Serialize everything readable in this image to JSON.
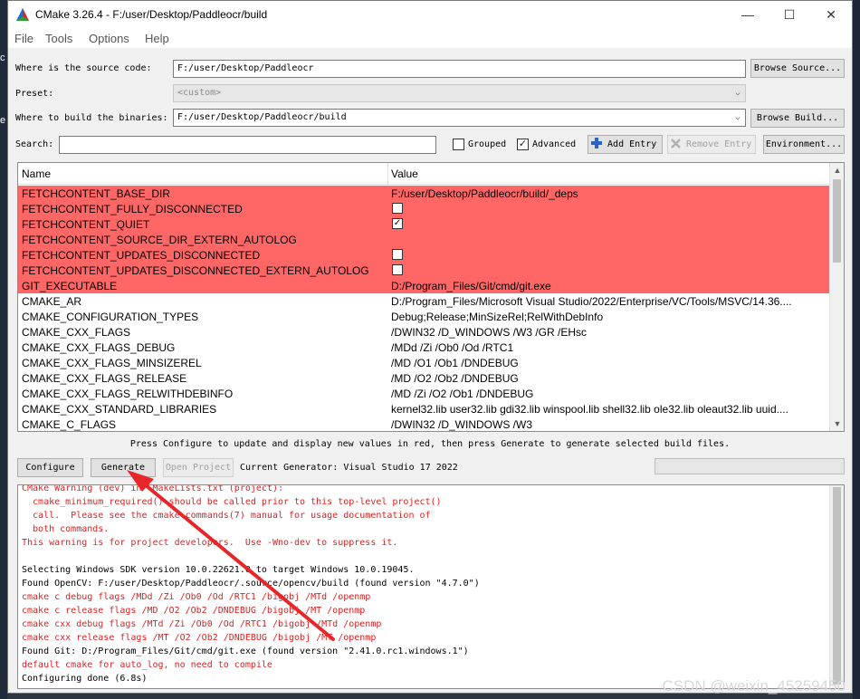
{
  "window": {
    "title": "CMake 3.26.4 - F:/user/Desktop/Paddleocr/build",
    "minimize_glyph": "—",
    "maximize_glyph": "☐",
    "close_glyph": "✕"
  },
  "menu": [
    "File",
    "Tools",
    "Options",
    "Help"
  ],
  "source": {
    "label": "Where is the source code:",
    "value": "F:/user/Desktop/Paddleocr",
    "button": "Browse Source..."
  },
  "preset": {
    "label": "Preset:",
    "value": "<custom>"
  },
  "build": {
    "label": "Where to build the binaries:",
    "value": "F:/user/Desktop/Paddleocr/build",
    "button": "Browse Build..."
  },
  "search": {
    "label": "Search:",
    "value": "",
    "grouped_label": "Grouped",
    "grouped_checked": false,
    "advanced_label": "Advanced",
    "advanced_checked": true,
    "add_entry": "Add Entry",
    "remove_entry": "Remove Entry",
    "environment": "Environment..."
  },
  "table": {
    "headers": [
      "Name",
      "Value"
    ],
    "rows": [
      {
        "name": "FETCHCONTENT_BASE_DIR",
        "value": "F:/user/Desktop/Paddleocr/build/_deps",
        "type": "text",
        "new": true
      },
      {
        "name": "FETCHCONTENT_FULLY_DISCONNECTED",
        "value": "",
        "type": "bool",
        "checked": false,
        "new": true
      },
      {
        "name": "FETCHCONTENT_QUIET",
        "value": "",
        "type": "bool",
        "checked": true,
        "new": true
      },
      {
        "name": "FETCHCONTENT_SOURCE_DIR_EXTERN_AUTOLOG",
        "value": "",
        "type": "text",
        "new": true
      },
      {
        "name": "FETCHCONTENT_UPDATES_DISCONNECTED",
        "value": "",
        "type": "bool",
        "checked": false,
        "new": true
      },
      {
        "name": "FETCHCONTENT_UPDATES_DISCONNECTED_EXTERN_AUTOLOG",
        "value": "",
        "type": "bool",
        "checked": false,
        "new": true
      },
      {
        "name": "GIT_EXECUTABLE",
        "value": "D:/Program_Files/Git/cmd/git.exe",
        "type": "text",
        "new": true
      },
      {
        "name": "CMAKE_AR",
        "value": "D:/Program_Files/Microsoft Visual Studio/2022/Enterprise/VC/Tools/MSVC/14.36....",
        "type": "text",
        "new": false
      },
      {
        "name": "CMAKE_CONFIGURATION_TYPES",
        "value": "Debug;Release;MinSizeRel;RelWithDebInfo",
        "type": "text",
        "new": false
      },
      {
        "name": "CMAKE_CXX_FLAGS",
        "value": "/DWIN32 /D_WINDOWS /W3 /GR /EHsc",
        "type": "text",
        "new": false
      },
      {
        "name": "CMAKE_CXX_FLAGS_DEBUG",
        "value": "/MDd /Zi /Ob0 /Od /RTC1",
        "type": "text",
        "new": false
      },
      {
        "name": "CMAKE_CXX_FLAGS_MINSIZEREL",
        "value": "/MD /O1 /Ob1 /DNDEBUG",
        "type": "text",
        "new": false
      },
      {
        "name": "CMAKE_CXX_FLAGS_RELEASE",
        "value": "/MD /O2 /Ob2 /DNDEBUG",
        "type": "text",
        "new": false
      },
      {
        "name": "CMAKE_CXX_FLAGS_RELWITHDEBINFO",
        "value": "/MD /Zi /O2 /Ob1 /DNDEBUG",
        "type": "text",
        "new": false
      },
      {
        "name": "CMAKE_CXX_STANDARD_LIBRARIES",
        "value": "kernel32.lib user32.lib gdi32.lib winspool.lib shell32.lib ole32.lib oleaut32.lib uuid....",
        "type": "text",
        "new": false
      },
      {
        "name": "CMAKE_C_FLAGS",
        "value": "/DWIN32 /D_WINDOWS /W3",
        "type": "text",
        "new": false
      }
    ]
  },
  "hint": "Press Configure to update and display new values in red, then press Generate to generate selected build files.",
  "actions": {
    "configure": "Configure",
    "generate": "Generate",
    "open_project": "Open Project",
    "generator_label": "Current Generator: Visual Studio 17 2022"
  },
  "output_lines": [
    {
      "text": "CMake Warning (dev) in CMakeLists.txt (project):",
      "color": "red"
    },
    {
      "text": "  cmake_minimum_required() should be called prior to this top-level project()",
      "color": "red"
    },
    {
      "text": "  call.  Please see the cmake-commands(7) manual for usage documentation of",
      "color": "red"
    },
    {
      "text": "  both commands.",
      "color": "red"
    },
    {
      "text": "This warning is for project developers.  Use -Wno-dev to suppress it.",
      "color": "red"
    },
    {
      "text": "",
      "color": "black"
    },
    {
      "text": "Selecting Windows SDK version 10.0.22621.0 to target Windows 10.0.19045.",
      "color": "black"
    },
    {
      "text": "Found OpenCV: F:/user/Desktop/Paddleocr/.source/opencv/build (found version \"4.7.0\")",
      "color": "black"
    },
    {
      "text": "cmake c debug flags /MDd /Zi /Ob0 /Od /RTC1 /bigobj /MTd /openmp",
      "color": "red"
    },
    {
      "text": "cmake c release flags /MD /O2 /Ob2 /DNDEBUG /bigobj /MT /openmp",
      "color": "red"
    },
    {
      "text": "cmake cxx debug flags /MTd /Zi /Ob0 /Od /RTC1 /bigobj /MTd /openmp",
      "color": "red"
    },
    {
      "text": "cmake cxx release flags /MT /O2 /Ob2 /DNDEBUG /bigobj /MT /openmp",
      "color": "red"
    },
    {
      "text": "Found Git: D:/Program_Files/Git/cmd/git.exe (found version \"2.41.0.rc1.windows.1\")",
      "color": "black"
    },
    {
      "text": "default cmake for auto_log, no need to compile",
      "color": "red"
    },
    {
      "text": "Configuring done (6.8s)",
      "color": "black"
    }
  ],
  "watermark": "CSDN @weixin_45259450",
  "colors": {
    "new_row": "#ff6666",
    "annotation_arrow": "#e8262a",
    "output_red": "#e02020"
  },
  "icons": {
    "app": "cmake-triangle-icon",
    "add": "plus-icon",
    "remove": "cross-icon"
  }
}
